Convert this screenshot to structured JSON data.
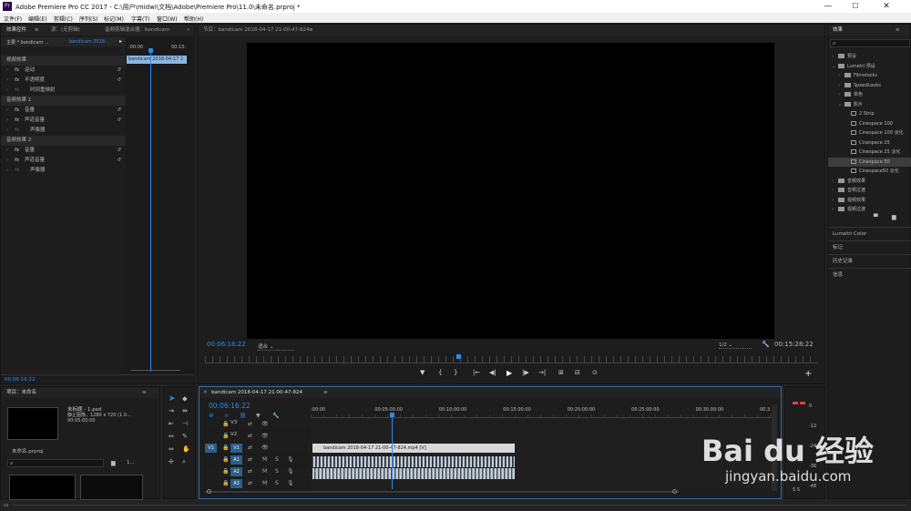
{
  "window": {
    "title": "Adobe Premiere Pro CC 2017 - C:\\用户\\midwi\\文档\\Adobe\\Premiere Pro\\11.0\\未命名.prproj *",
    "logo": "Pr",
    "min": "—",
    "max": "☐",
    "close": "✕"
  },
  "menu": [
    "文件(F)",
    "编辑(E)",
    "剪辑(C)",
    "序列(S)",
    "标记(M)",
    "字幕(T)",
    "窗口(W)",
    "帮助(H)"
  ],
  "effect_controls": {
    "tabs": [
      "效果控件",
      "源：(无剪辑)",
      "音频剪辑混合器：bandicam"
    ],
    "menu_icon": "≡",
    "overflow": "»",
    "master_label": "主要 * bandicam ...",
    "clip_label": "bandicam 2018...",
    "ruler": {
      "start": ":00:00",
      "end": "00:15:"
    },
    "clip_bar": "bandicam 2018-04-17 2",
    "rows": [
      {
        "text": "视频效果",
        "kind": "section",
        "icon": ""
      },
      {
        "text": "运动",
        "kind": "fx",
        "icon": "↺"
      },
      {
        "text": "不透明度",
        "kind": "fx",
        "icon": "↺"
      },
      {
        "text": "时间重映射",
        "kind": "sub",
        "icon": ""
      },
      {
        "text": "音频效果 1",
        "kind": "section",
        "icon": ""
      },
      {
        "text": "音量",
        "kind": "fx",
        "icon": "↺"
      },
      {
        "text": "声道音量",
        "kind": "fx",
        "icon": "↺"
      },
      {
        "text": "声像器",
        "kind": "sub",
        "icon": ""
      },
      {
        "text": "音频效果 2",
        "kind": "section",
        "icon": ""
      },
      {
        "text": "音量",
        "kind": "fx",
        "icon": "↺"
      },
      {
        "text": "声道音量",
        "kind": "fx",
        "icon": "↺"
      },
      {
        "text": "声像器",
        "kind": "sub",
        "icon": ""
      }
    ],
    "timecode": "00:06:16:22"
  },
  "program": {
    "title": "节目：bandicam 2018-04-17 21-00-47-824",
    "menu_icon": "≡",
    "timecode": "00:06:16:22",
    "fit": "适合",
    "resolution": "1/2",
    "duration": "00:15:28:22",
    "playhead_fraction": 0.41,
    "controls": [
      "▼",
      "{",
      "}",
      "|←",
      "◀|",
      "▶",
      "|▶",
      "→|",
      "⊞",
      "⊟",
      "⊙"
    ],
    "add": "+"
  },
  "project": {
    "title": "项目：未命名",
    "menu_icon": "≡",
    "item_name": "未标题 - 1.psd",
    "item_meta1": "静止图像，1280 x 720 (1.0...",
    "item_meta2": "00:05:00:00",
    "project_file": "未命名.prproj",
    "items_count": "1..."
  },
  "timeline": {
    "tab": "bandicam 2018-04-17 21-00-47-824",
    "menu_icon": "≡",
    "timecode": "00:06:16:22",
    "ruler": [
      ":00:00",
      "00:05:00:00",
      "00:10:00:00",
      "00:15:00:00",
      "00:20:00:00",
      "00:25:00:00",
      "00:30:00:00",
      "00:3"
    ],
    "playhead_fraction": 0.177,
    "tracks": [
      {
        "src": "",
        "name": "V3",
        "kind": "video"
      },
      {
        "src": "",
        "name": "V2",
        "kind": "video"
      },
      {
        "src": "V1",
        "name": "V1",
        "kind": "video"
      },
      {
        "src": "",
        "name": "A1",
        "kind": "audio"
      },
      {
        "src": "",
        "name": "A2",
        "kind": "audio"
      },
      {
        "src": "",
        "name": "A3",
        "kind": "audio"
      }
    ],
    "video_clip": "bandicam 2018-04-17 21-00-47-824.mp4 [V]",
    "clip_end_fraction": 0.43,
    "meter_ticks": [
      "0",
      "-12",
      "-24",
      "-36",
      "-48"
    ],
    "meter_bottom": "S S"
  },
  "effects": {
    "title": "效果",
    "menu_icon": "≡",
    "search_placeholder": "",
    "tree": [
      {
        "depth": 0,
        "arrow": "›",
        "icon": "folder",
        "text": "预设"
      },
      {
        "depth": 0,
        "arrow": "⌄",
        "icon": "folder",
        "text": "Lumetri 预设"
      },
      {
        "depth": 1,
        "arrow": "›",
        "icon": "folder",
        "text": "Filmstocks"
      },
      {
        "depth": 1,
        "arrow": "›",
        "icon": "folder",
        "text": "SpeedLooks"
      },
      {
        "depth": 1,
        "arrow": "›",
        "icon": "folder",
        "text": "单色"
      },
      {
        "depth": 1,
        "arrow": "⌄",
        "icon": "folder",
        "text": "影片"
      },
      {
        "depth": 2,
        "arrow": "",
        "icon": "preset",
        "text": "2 Strip"
      },
      {
        "depth": 2,
        "arrow": "",
        "icon": "preset",
        "text": "Cinespace 100"
      },
      {
        "depth": 2,
        "arrow": "",
        "icon": "preset",
        "text": "Cinespace 100 淡化"
      },
      {
        "depth": 2,
        "arrow": "",
        "icon": "preset",
        "text": "Cinespace 25"
      },
      {
        "depth": 2,
        "arrow": "",
        "icon": "preset",
        "text": "Cinespace 25 淡化"
      },
      {
        "depth": 2,
        "arrow": "",
        "icon": "preset",
        "text": "Cinespace 50",
        "selected": true
      },
      {
        "depth": 2,
        "arrow": "",
        "icon": "preset",
        "text": "Cinespace50 淡化"
      },
      {
        "depth": 0,
        "arrow": "›",
        "icon": "folder",
        "text": "音频效果"
      },
      {
        "depth": 0,
        "arrow": "›",
        "icon": "folder",
        "text": "音频过渡"
      },
      {
        "depth": 0,
        "arrow": "›",
        "icon": "folder",
        "text": "视频效果"
      },
      {
        "depth": 0,
        "arrow": "›",
        "icon": "folder",
        "text": "视频过渡"
      }
    ],
    "sections": [
      "Lumetri Color",
      "标记",
      "历史记录",
      "信息"
    ]
  },
  "watermark": {
    "brand": "Bai du 经验",
    "url": "jingyan.baidu.com"
  }
}
